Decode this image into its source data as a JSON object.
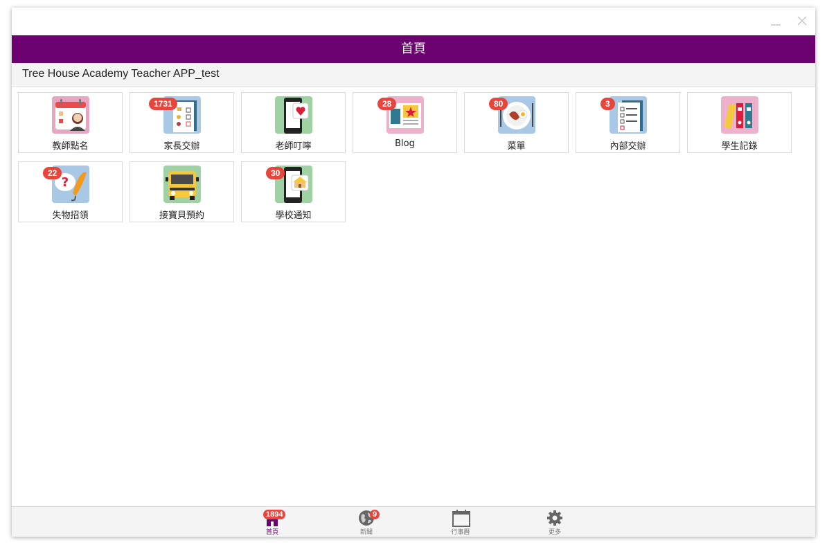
{
  "window": {
    "minimize_icon": "minimize-icon",
    "close_icon": "close-icon"
  },
  "header": {
    "title": "首頁"
  },
  "school": {
    "name": "Tree House Academy Teacher APP_test"
  },
  "tiles": [
    {
      "label": "教師點名",
      "badge": null,
      "icon": "teacher-attendance-icon"
    },
    {
      "label": "家長交辦",
      "badge": "1731",
      "icon": "parent-tasks-icon"
    },
    {
      "label": "老師叮嚀",
      "badge": null,
      "icon": "teacher-reminder-icon"
    },
    {
      "label": "Blog",
      "badge": "28",
      "icon": "blog-icon"
    },
    {
      "label": "菜單",
      "badge": "80",
      "icon": "menu-food-icon"
    },
    {
      "label": "內部交辦",
      "badge": "3",
      "icon": "internal-tasks-icon"
    },
    {
      "label": "學生記錄",
      "badge": null,
      "icon": "student-records-icon"
    },
    {
      "label": "失物招領",
      "badge": "22",
      "icon": "lost-and-found-icon"
    },
    {
      "label": "接寶貝預約",
      "badge": null,
      "icon": "school-bus-icon"
    },
    {
      "label": "學校通知",
      "badge": "30",
      "icon": "school-notice-icon"
    }
  ],
  "bottom_nav": {
    "tabs": [
      {
        "label": "首頁",
        "badge": "1894",
        "icon": "home-icon",
        "active": true
      },
      {
        "label": "新聞",
        "badge": "9",
        "icon": "globe-icon",
        "active": false
      },
      {
        "label": "行事曆",
        "badge": null,
        "icon": "calendar-icon",
        "active": false
      },
      {
        "label": "更多",
        "badge": null,
        "icon": "gear-icon",
        "active": false
      }
    ]
  },
  "colors": {
    "brand_purple": "#6c0170",
    "badge_red": "#e8453c",
    "toolbar_gray": "#f4f4f4"
  }
}
